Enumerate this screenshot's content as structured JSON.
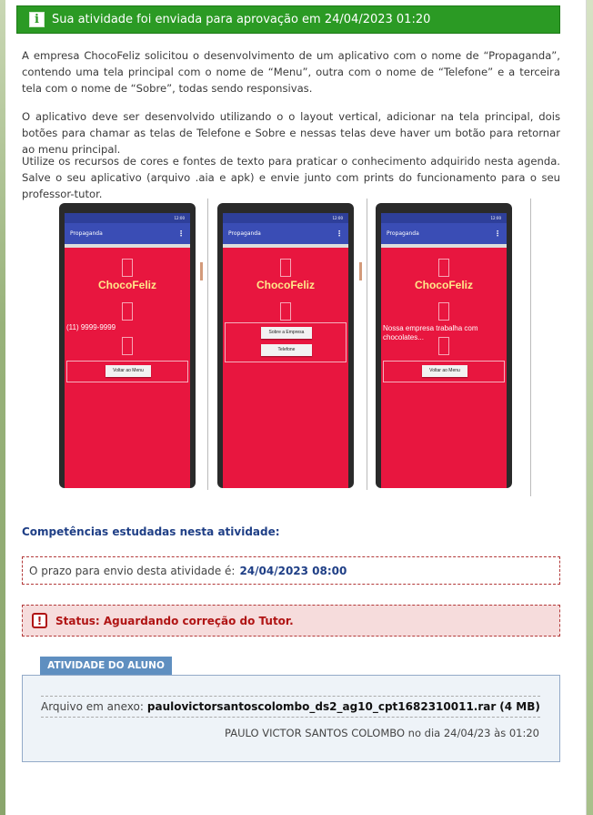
{
  "banner": {
    "icon": "info-icon",
    "text": "Sua atividade foi enviada para aprovação em 24/04/2023 01:20"
  },
  "paragraphs": [
    "A empresa ChocoFeliz solicitou o desenvolvimento de um aplicativo com o nome de “Propaganda”, contendo uma tela principal com o nome de “Menu”, outra com o nome de “Telefone” e a terceira tela com o nome de “Sobre”, todas sendo responsivas.",
    "O aplicativo deve ser desenvolvido utilizando o o layout vertical, adicionar na tela principal, dois botões para chamar as telas de Telefone e Sobre e nessas telas deve haver um botão para retornar ao menu principal.",
    "Utilize os recursos de cores e fontes de texto para praticar o conhecimento adquirido nesta agenda. Salve o seu aplicativo (arquivo .aia e apk) e envie junto com prints do funcionamento para o seu professor-tutor."
  ],
  "phones": [
    {
      "status_time": "12:00",
      "app_title": "Propaganda",
      "brand": "ChocoFeliz",
      "body_text": "(11) 9999-9999",
      "buttons": [
        "Voltar ao Menu"
      ]
    },
    {
      "status_time": "12:00",
      "app_title": "Propaganda",
      "brand": "ChocoFeliz",
      "body_text": "",
      "buttons": [
        "Sobre a Empresa",
        "Telefone"
      ]
    },
    {
      "status_time": "12:00",
      "app_title": "Propaganda",
      "brand": "ChocoFeliz",
      "body_text": "Nossa empresa trabalha com chocolates...",
      "buttons": [
        "Voltar ao Menu"
      ]
    }
  ],
  "competencias": {
    "title": "Competências estudadas nesta atividade:"
  },
  "deadline": {
    "label": "O prazo para envio desta atividade é:",
    "value": "24/04/2023 08:00"
  },
  "status": {
    "icon": "alert-icon",
    "text": "Status: Aguardando correção do Tutor."
  },
  "student_section": {
    "tab_label": "ATIVIDADE DO ALUNO",
    "attachment_label": "Arquivo em anexo:",
    "file_name": "paulovictorsantoscolombo_ds2_ag10_cpt1682310011.rar",
    "file_size": "(4 MB)",
    "byline": "PAULO VICTOR SANTOS COLOMBO no dia 24/04/23 às 01:20"
  },
  "colors": {
    "banner_green": "#2b9a24",
    "phone_red": "#e8163f",
    "app_bar": "#3a4db5",
    "status_red": "#b01414",
    "title_blue": "#1f3f86",
    "tab_blue": "#5f8fc0"
  }
}
